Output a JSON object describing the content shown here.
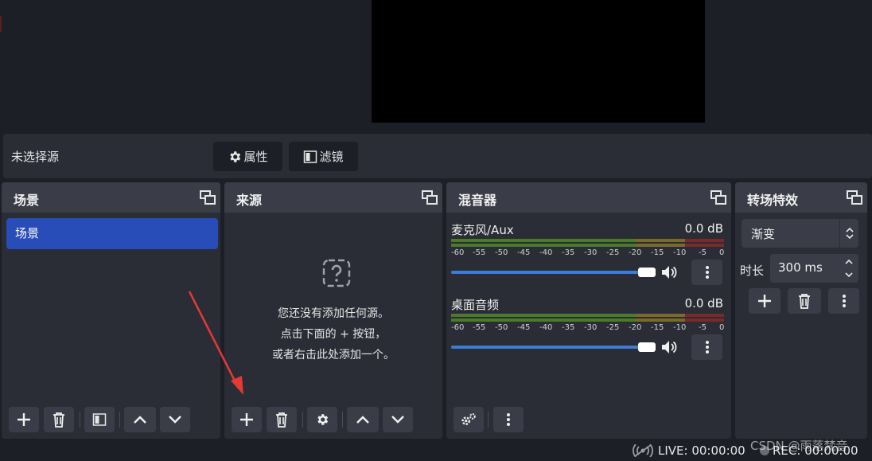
{
  "context_bar": {
    "label": "未选择源",
    "properties_label": "属性",
    "filters_label": "滤镜"
  },
  "scenes": {
    "title": "场景",
    "items": [
      "场景"
    ]
  },
  "sources": {
    "title": "来源",
    "empty_line1": "您还没有添加任何源。",
    "empty_line2": "点击下面的 + 按钮，",
    "empty_line3": "或者右击此处添加一个。"
  },
  "mixer": {
    "title": "混音器",
    "tracks": [
      {
        "name": "麦克风/Aux",
        "level": "0.0 dB",
        "volume": 1.0
      },
      {
        "name": "桌面音频",
        "level": "0.0 dB",
        "volume": 1.0
      }
    ],
    "ticks": [
      "-60",
      "-55",
      "-50",
      "-45",
      "-40",
      "-35",
      "-30",
      "-25",
      "-20",
      "-15",
      "-10",
      "-5",
      "0"
    ]
  },
  "transitions": {
    "title": "转场特效",
    "selected": "渐变",
    "duration_label": "时长",
    "duration_value": "300 ms"
  },
  "status": {
    "live": "LIVE: 00:00:00",
    "rec": "REC: 00:00:00"
  },
  "watermark": "CSDN @雨落梵音",
  "colors": {
    "accent": "#284cb8",
    "slider": "#3d7bd6",
    "annotation_arrow": "#e53935"
  }
}
